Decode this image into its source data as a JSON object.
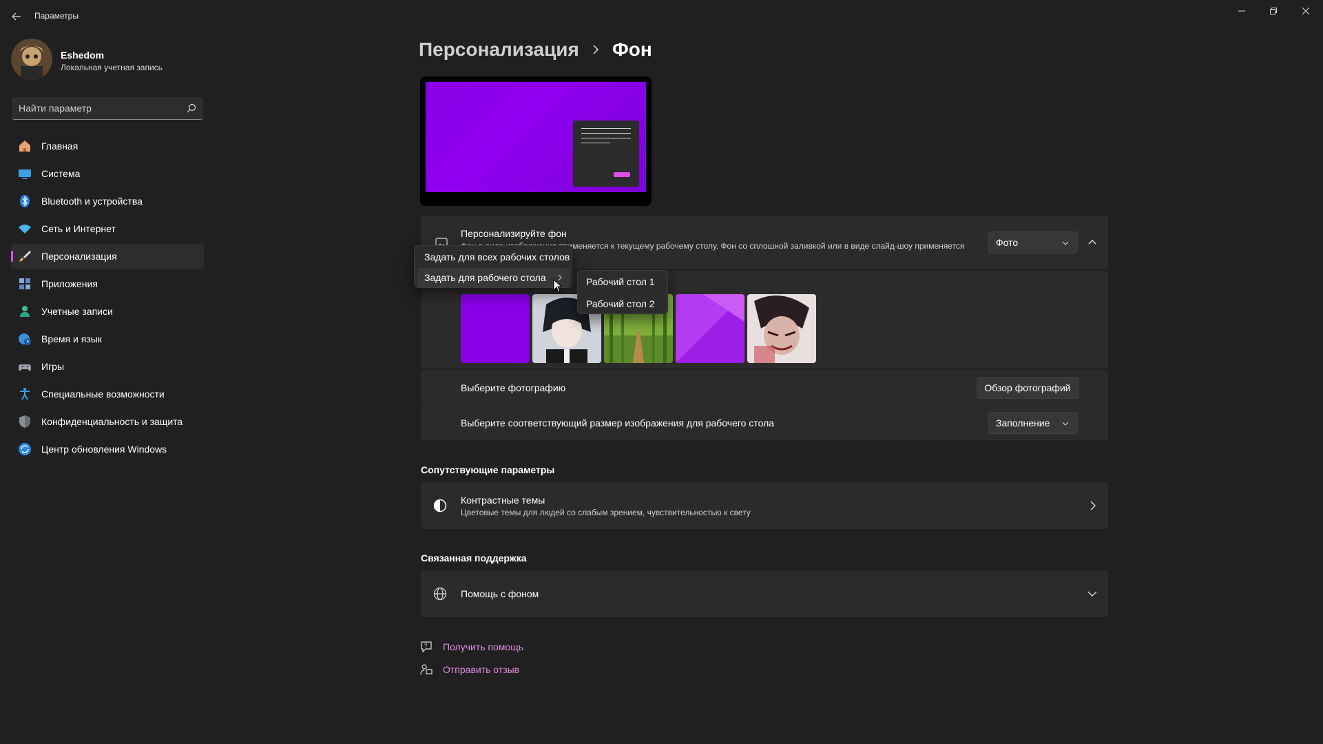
{
  "window": {
    "title": "Параметры"
  },
  "profile": {
    "name": "Eshedom",
    "account_type": "Локальная учетная запись"
  },
  "search": {
    "placeholder": "Найти параметр"
  },
  "nav": {
    "items": [
      {
        "label": "Главная",
        "icon": "home-icon"
      },
      {
        "label": "Система",
        "icon": "system-icon"
      },
      {
        "label": "Bluetooth и устройства",
        "icon": "bluetooth-icon"
      },
      {
        "label": "Сеть и Интернет",
        "icon": "wifi-icon"
      },
      {
        "label": "Персонализация",
        "icon": "brush-icon",
        "active": true
      },
      {
        "label": "Приложения",
        "icon": "apps-icon"
      },
      {
        "label": "Учетные записи",
        "icon": "person-icon"
      },
      {
        "label": "Время и язык",
        "icon": "globe-clock-icon"
      },
      {
        "label": "Игры",
        "icon": "gamepad-icon"
      },
      {
        "label": "Специальные возможности",
        "icon": "accessibility-icon"
      },
      {
        "label": "Конфиденциальность и защита",
        "icon": "shield-icon"
      },
      {
        "label": "Центр обновления Windows",
        "icon": "update-icon"
      }
    ]
  },
  "breadcrumb": {
    "parent": "Персонализация",
    "current": "Фон"
  },
  "personalize": {
    "title": "Персонализируйте фон",
    "description": "Фон в виде изображения применяется к текущему рабочему столу. Фон со сплошной заливкой или в виде слайд-шоу применяется",
    "dropdown_value": "Фото"
  },
  "choose_photo": {
    "label": "Выберите фотографию",
    "button": "Обзор фотографий"
  },
  "fit": {
    "label": "Выберите соответствующий размер изображения для рабочего стола",
    "dropdown_value": "Заполнение"
  },
  "related": {
    "section_title": "Сопутствующие параметры",
    "contrast_title": "Контрастные темы",
    "contrast_desc": "Цветовые темы для людей со слабым зрением, чувствительностью к свету"
  },
  "support": {
    "section_title": "Связанная поддержка",
    "help_title": "Помощь с фоном"
  },
  "links": {
    "get_help": "Получить помощь",
    "feedback": "Отправить отзыв"
  },
  "context_menu": {
    "items": [
      "Задать для всех рабочих столов",
      "Задать для рабочего стола"
    ],
    "submenu": [
      "Рабочий стол 1",
      "Рабочий стол 2"
    ]
  },
  "colors": {
    "accent": "#e14de6",
    "background": "#202020",
    "card": "#2b2b2b",
    "link": "#e38ce6"
  }
}
